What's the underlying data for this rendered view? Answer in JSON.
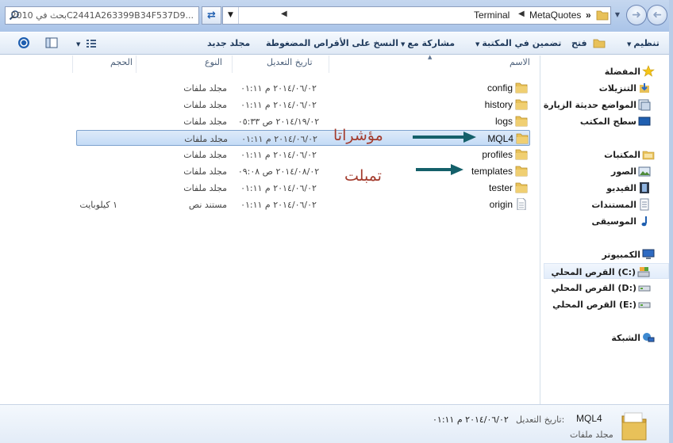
{
  "address_bar": {
    "crumbs": [
      "MetaQuotes",
      "Terminal"
    ],
    "overflow": "»"
  },
  "search": {
    "text": "بحث في 2010C2441A263399B34F537D9..."
  },
  "toolbar": {
    "organize": "تنظيم",
    "open": "فتح",
    "include_in_library": "تضمين في المكتبة",
    "share_with": "مشاركة مع",
    "burn": "النسخ على الأقراص المضغوطة",
    "new_folder": "مجلد جديد"
  },
  "navpane": {
    "favorites": "المفضلة",
    "downloads": "التنزيلات",
    "recent_places": "المواضع حديثة الزيارة",
    "desktop": "سطح المكتب",
    "libraries": "المكتبات",
    "pictures": "الصور",
    "videos": "الفيديو",
    "documents": "المستندات",
    "music": "الموسيقى",
    "computer": "الكمبيوتر",
    "drive_c": "القرص المحلي (C:)",
    "drive_d": "القرص المحلي (D:)",
    "drive_e": "القرص المحلي (E:)",
    "network": "الشبكة"
  },
  "columns": {
    "name": "الاسم",
    "date_modified": "تاريخ التعديل",
    "type": "النوع",
    "size": "الحجم"
  },
  "files": [
    {
      "name": "config",
      "date": "٢٠١٤/٠٦/٠٢ م ٠١:١١",
      "type": "مجلد ملفات",
      "size": ""
    },
    {
      "name": "history",
      "date": "٢٠١٤/٠٦/٠٢ م ٠١:١١",
      "type": "مجلد ملفات",
      "size": ""
    },
    {
      "name": "logs",
      "date": "٢٠١٤/١٩/٠٢ ص ٠٥:٣٣",
      "type": "مجلد ملفات",
      "size": ""
    },
    {
      "name": "MQL4",
      "date": "٢٠١٤/٠٦/٠٢ م ٠١:١١",
      "type": "مجلد ملفات",
      "size": ""
    },
    {
      "name": "profiles",
      "date": "٢٠١٤/٠٦/٠٢ م ٠١:١١",
      "type": "مجلد ملفات",
      "size": ""
    },
    {
      "name": "templates",
      "date": "٢٠١٤/٠٨/٠٢ ص ٠٩:٠٨",
      "type": "مجلد ملفات",
      "size": ""
    },
    {
      "name": "tester",
      "date": "٢٠١٤/٠٦/٠٢ م ٠١:١١",
      "type": "مجلد ملفات",
      "size": ""
    },
    {
      "name": "origin",
      "date": "٢٠١٤/٠٦/٠٢ م ٠١:١١",
      "type": "مستند نص",
      "size": "١ كيلوبايت"
    }
  ],
  "annotations": {
    "indicators": "مؤشراتا",
    "templates": "تمبلت"
  },
  "details": {
    "name": "MQL4",
    "date_label": "تاريخ التعديل:",
    "date": "٢٠١٤/٠٦/٠٢ م ٠١:١١",
    "type": "مجلد ملفات"
  },
  "colors": {
    "folder": "#e8c159",
    "selection": "#c4dbf6",
    "annotation_text": "#a33b2d",
    "annotation_arrow": "#14606a"
  }
}
